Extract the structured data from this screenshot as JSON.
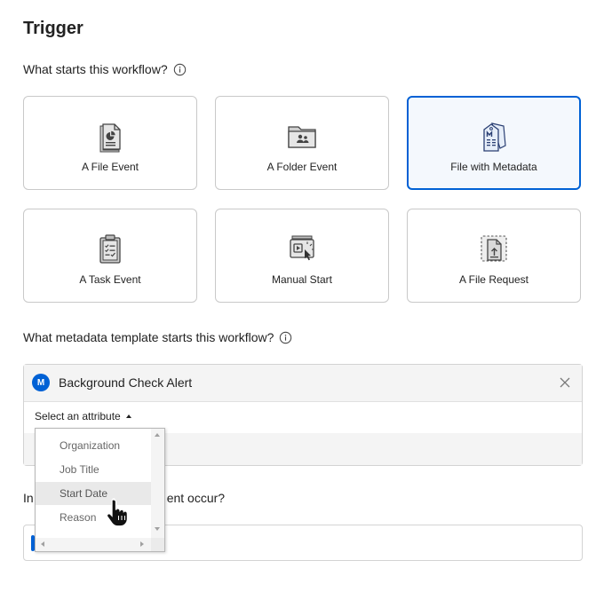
{
  "trigger": {
    "title": "Trigger",
    "question": "What starts this workflow?",
    "options": [
      {
        "label": "A File Event",
        "icon": "file-chart-icon"
      },
      {
        "label": "A Folder Event",
        "icon": "folder-people-icon"
      },
      {
        "label": "File with Metadata",
        "icon": "metadata-file-icon",
        "selected": true
      },
      {
        "label": "A Task Event",
        "icon": "clipboard-task-icon"
      },
      {
        "label": "Manual Start",
        "icon": "manual-start-icon"
      },
      {
        "label": "A File Request",
        "icon": "file-request-icon"
      }
    ]
  },
  "metadata": {
    "question": "What metadata template starts this workflow?",
    "template_badge": "M",
    "template_name": "Background Check Alert",
    "attribute_placeholder": "Select an attribute",
    "attribute_options": [
      "Organization",
      "Job Title",
      "Start Date",
      "Reason"
    ],
    "highlighted_option": "Start Date"
  },
  "event": {
    "question_start": "In",
    "question_end": "ent occur?"
  },
  "colors": {
    "accent": "#0061d5",
    "border": "#c9c9c9",
    "text": "#222222"
  }
}
